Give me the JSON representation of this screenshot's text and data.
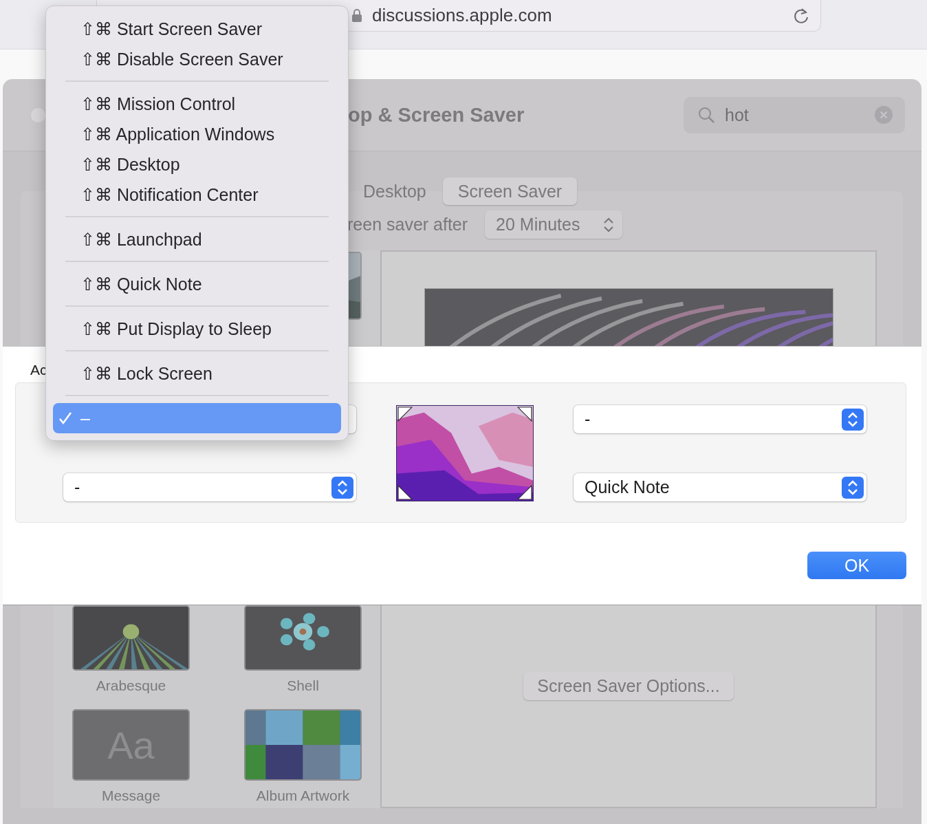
{
  "browser": {
    "url": "discussions.apple.com"
  },
  "window": {
    "title": "op & Screen Saver",
    "search": {
      "value": "hot"
    },
    "tabs": [
      {
        "label": "Desktop",
        "selected": false
      },
      {
        "label": "Screen Saver",
        "selected": true
      }
    ],
    "start_after": {
      "label": "reen saver after",
      "value": "20 Minutes"
    },
    "savers": [
      {
        "name": "Arabesque",
        "kind": "rays"
      },
      {
        "name": "Shell",
        "kind": "flower"
      },
      {
        "name": "Message",
        "kind": "text",
        "sample": "Aa"
      },
      {
        "name": "Album Artwork",
        "kind": "collage"
      }
    ],
    "options_button": "Screen Saver Options..."
  },
  "sheet": {
    "label": "Ac",
    "top_right": {
      "value": "-"
    },
    "bottom_left": {
      "value": "-"
    },
    "bottom_right": {
      "value": "Quick Note"
    },
    "ok_button": "OK"
  },
  "menu": {
    "groups": [
      {
        "items": [
          {
            "label": "⇧⌘ Start Screen Saver",
            "selected": false
          },
          {
            "label": "⇧⌘ Disable Screen Saver",
            "selected": false
          }
        ]
      },
      {
        "items": [
          {
            "label": "⇧⌘ Mission Control",
            "selected": false
          },
          {
            "label": "⇧⌘ Application Windows",
            "selected": false
          },
          {
            "label": "⇧⌘ Desktop",
            "selected": false
          },
          {
            "label": "⇧⌘ Notification Center",
            "selected": false
          }
        ]
      },
      {
        "items": [
          {
            "label": "⇧⌘ Launchpad",
            "selected": false
          }
        ]
      },
      {
        "items": [
          {
            "label": "⇧⌘ Quick Note",
            "selected": false
          }
        ]
      },
      {
        "items": [
          {
            "label": "⇧⌘ Put Display to Sleep",
            "selected": false
          }
        ]
      },
      {
        "items": [
          {
            "label": "⇧⌘ Lock Screen",
            "selected": false
          }
        ]
      },
      {
        "items": [
          {
            "label": "–",
            "selected": true
          }
        ]
      }
    ]
  }
}
